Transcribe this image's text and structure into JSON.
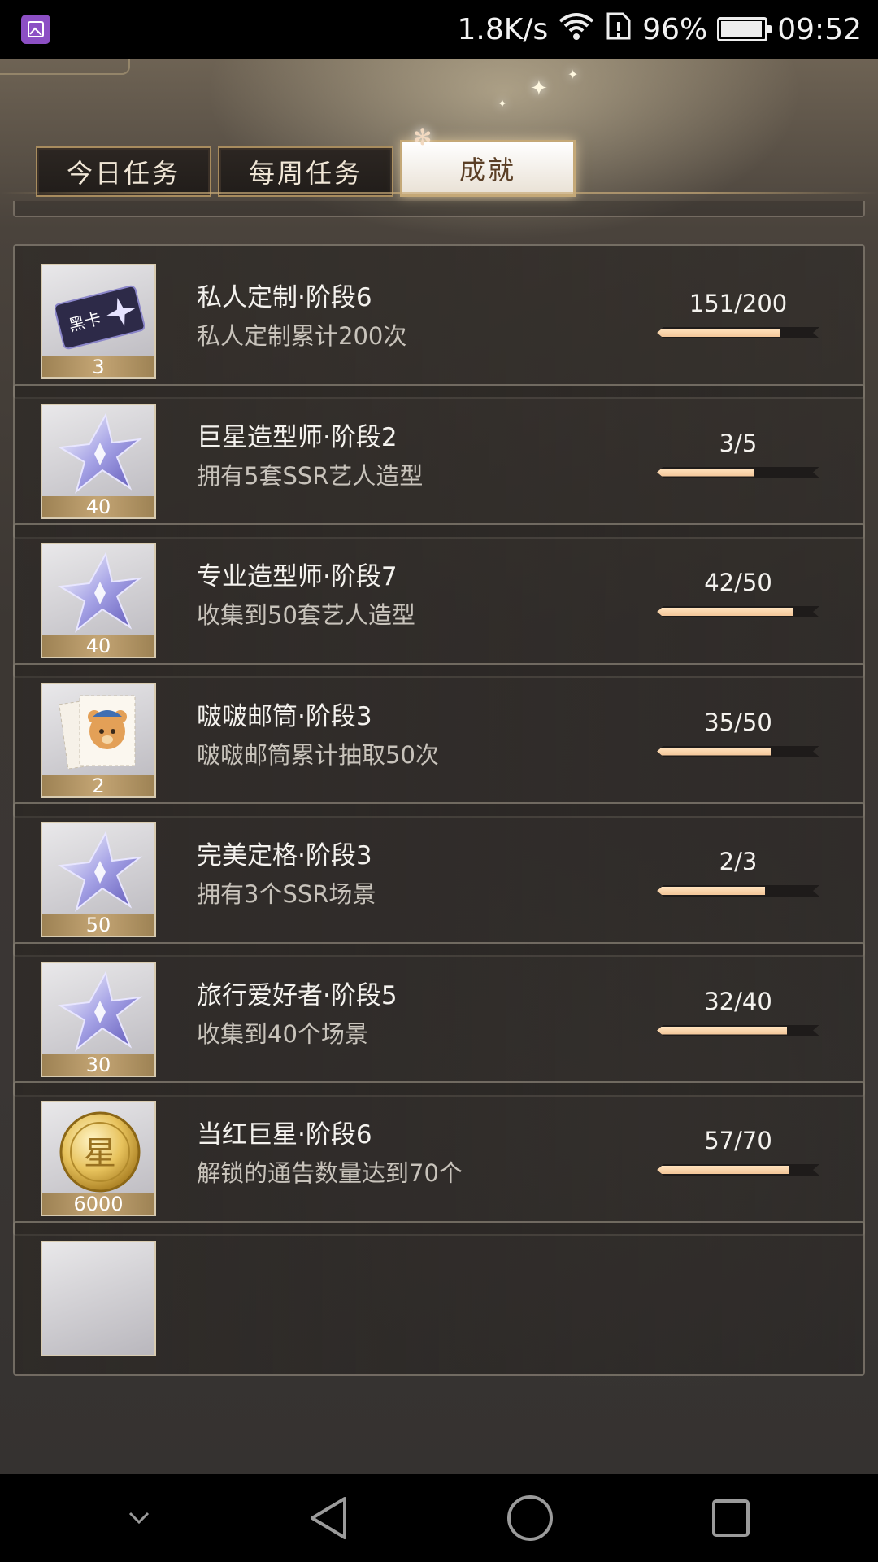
{
  "status_bar": {
    "network_speed": "1.8K/s",
    "battery_percent": "96%",
    "battery_level": 0.96,
    "time": "09:52",
    "icons": [
      "gallery-app-icon",
      "wifi-icon",
      "sim-alert-icon",
      "battery-icon"
    ]
  },
  "tabs": [
    {
      "label": "今日任务",
      "active": false
    },
    {
      "label": "每周任务",
      "active": false
    },
    {
      "label": "成就",
      "active": true
    }
  ],
  "achievements": [
    {
      "title": "私人定制·阶段6",
      "desc": "私人定制累计200次",
      "progress_text": "151/200",
      "progress": 0.755,
      "reward_icon": "black-card-icon",
      "reward_count": "3"
    },
    {
      "title": "巨星造型师·阶段2",
      "desc": "拥有5套SSR艺人造型",
      "progress_text": "3/5",
      "progress": 0.6,
      "reward_icon": "star-crystal-icon",
      "reward_count": "40"
    },
    {
      "title": "专业造型师·阶段7",
      "desc": "收集到50套艺人造型",
      "progress_text": "42/50",
      "progress": 0.84,
      "reward_icon": "star-crystal-icon",
      "reward_count": "40"
    },
    {
      "title": "啵啵邮筒·阶段3",
      "desc": "啵啵邮筒累计抽取50次",
      "progress_text": "35/50",
      "progress": 0.7,
      "reward_icon": "bear-stamp-icon",
      "reward_count": "2"
    },
    {
      "title": "完美定格·阶段3",
      "desc": "拥有3个SSR场景",
      "progress_text": "2/3",
      "progress": 0.667,
      "reward_icon": "star-crystal-icon",
      "reward_count": "50"
    },
    {
      "title": "旅行爱好者·阶段5",
      "desc": "收集到40个场景",
      "progress_text": "32/40",
      "progress": 0.8,
      "reward_icon": "star-crystal-icon",
      "reward_count": "30"
    },
    {
      "title": "当红巨星·阶段6",
      "desc": "解锁的通告数量达到70个",
      "progress_text": "57/70",
      "progress": 0.814,
      "reward_icon": "gold-star-coin-icon",
      "reward_count": "6000"
    }
  ],
  "nav_bar": {
    "icons": [
      "collapse-chevron-icon",
      "back-icon",
      "home-icon",
      "recents-icon"
    ]
  },
  "colors": {
    "progress_fill": "#f3c699",
    "tab_border": "#a88c5e",
    "active_tab_text": "#5a3e25"
  }
}
